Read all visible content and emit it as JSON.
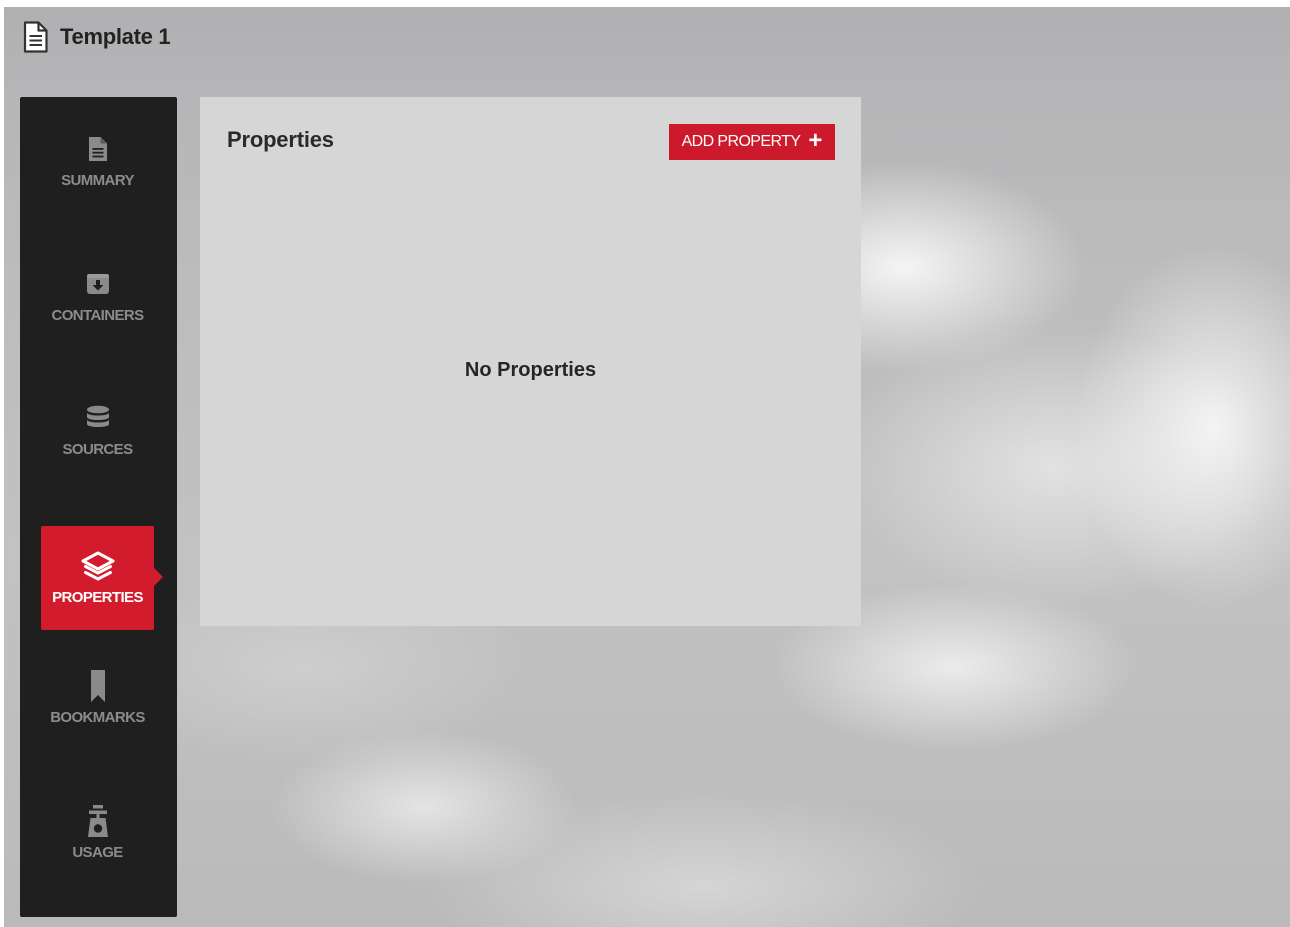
{
  "header": {
    "icon": "document-icon",
    "title": "Template 1"
  },
  "sidebar": {
    "items": [
      {
        "label": "SUMMARY",
        "icon": "document-icon",
        "active": false
      },
      {
        "label": "CONTAINERS",
        "icon": "inbox-download-icon",
        "active": false
      },
      {
        "label": "SOURCES",
        "icon": "database-icon",
        "active": false
      },
      {
        "label": "PROPERTIES",
        "icon": "layers-icon",
        "active": true
      },
      {
        "label": "BOOKMARKS",
        "icon": "bookmark-icon",
        "active": false
      },
      {
        "label": "USAGE",
        "icon": "scale-icon",
        "active": false
      }
    ]
  },
  "main": {
    "title": "Properties",
    "add_button_label": "ADD PROPERTY",
    "add_button_icon": "plus-icon",
    "empty_message": "No Properties"
  },
  "colors": {
    "accent": "#d21c2e",
    "sidebar_bg": "#1f1f1f",
    "panel_bg": "#d6d6d6"
  }
}
